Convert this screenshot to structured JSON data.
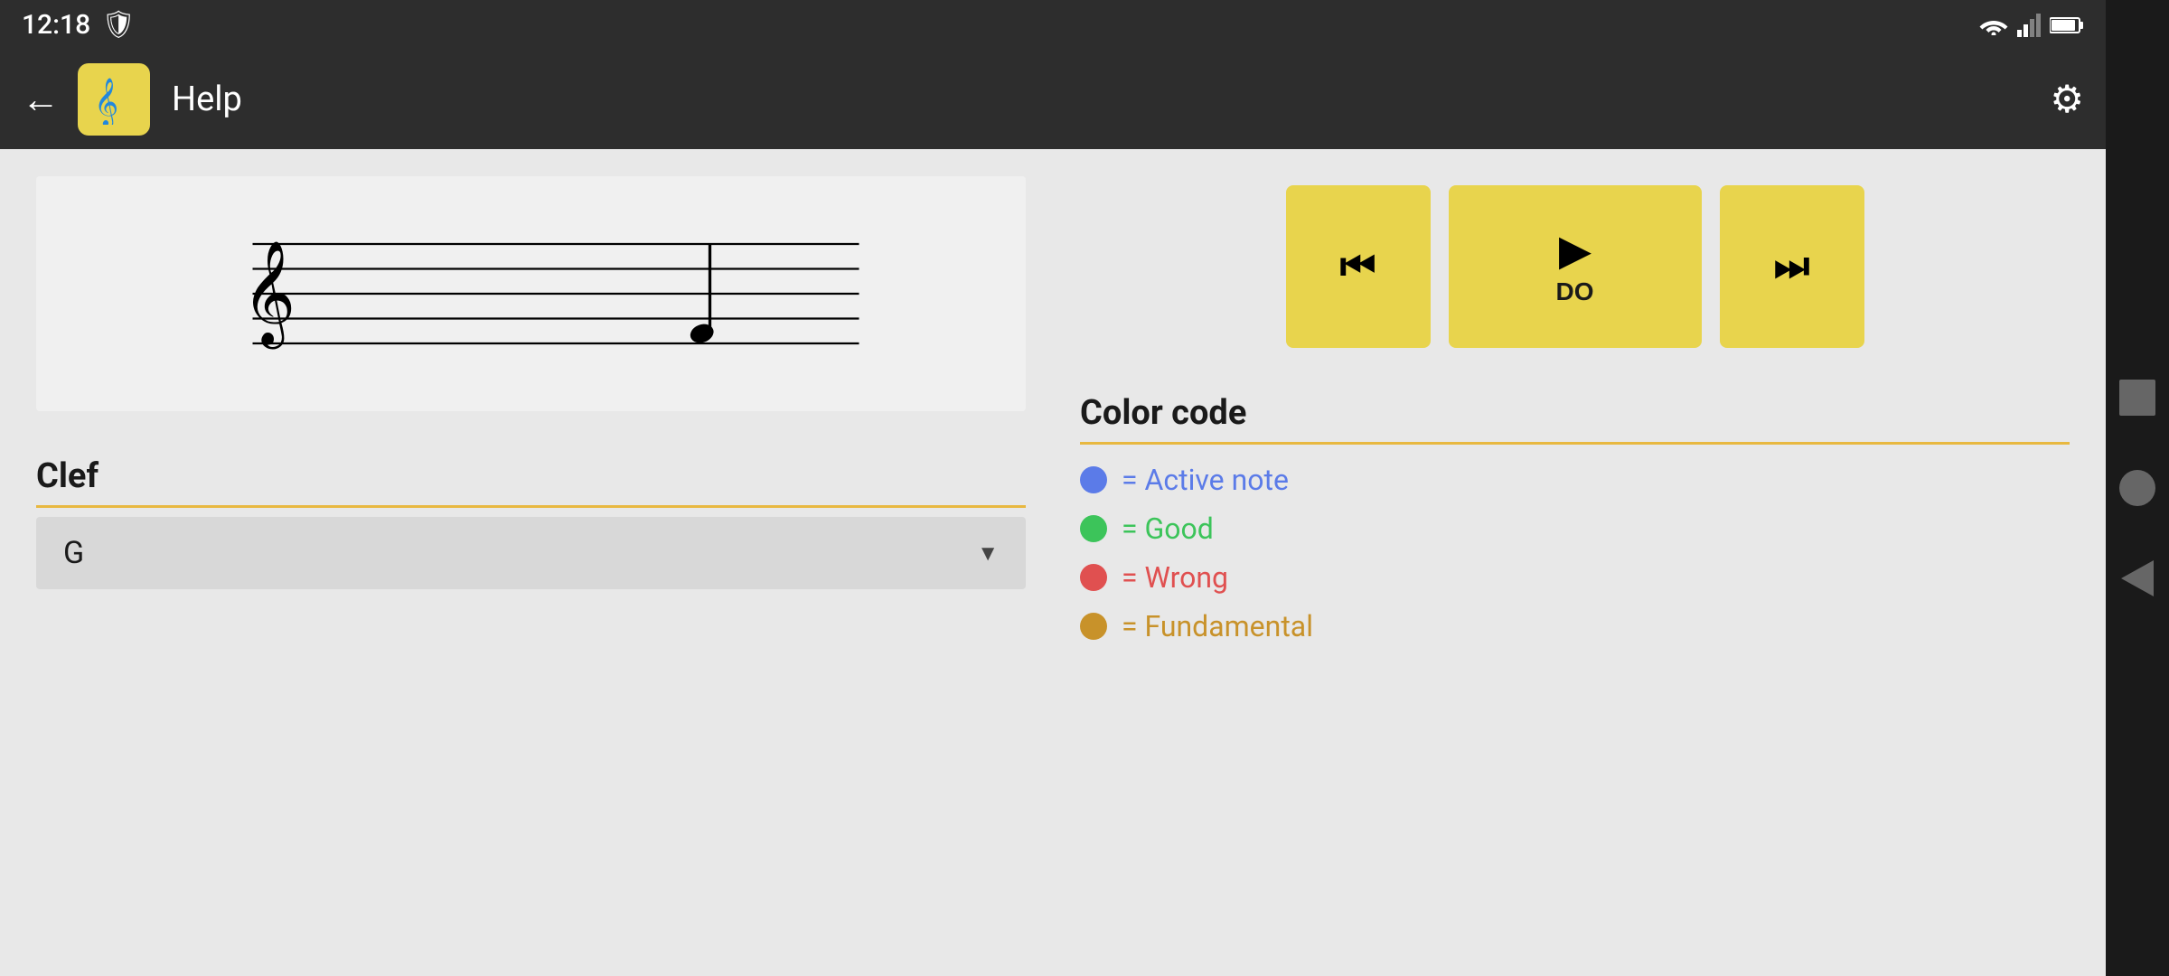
{
  "status_bar": {
    "time": "12:18",
    "shield_icon": "🛡",
    "wifi_icon": "wifi",
    "signal_icon": "signal",
    "battery_icon": "battery"
  },
  "app_bar": {
    "back_label": "←",
    "app_icon_symbol": "𝄞",
    "title": "Help",
    "settings_icon": "⚙"
  },
  "playback": {
    "skip_back_label": "⏮",
    "play_label": "▶",
    "play_sublabel": "DO",
    "skip_forward_label": "⏭"
  },
  "clef_section": {
    "title": "Clef",
    "dropdown_value": "G",
    "dropdown_arrow": "▼"
  },
  "color_code": {
    "title": "Color code",
    "items": [
      {
        "color": "#5B7BE8",
        "label": "= Active note"
      },
      {
        "color": "#3CC45A",
        "label": "= Good"
      },
      {
        "color": "#E05050",
        "label": "= Wrong"
      },
      {
        "color": "#C8922A",
        "label": "= Fundamental"
      }
    ]
  }
}
